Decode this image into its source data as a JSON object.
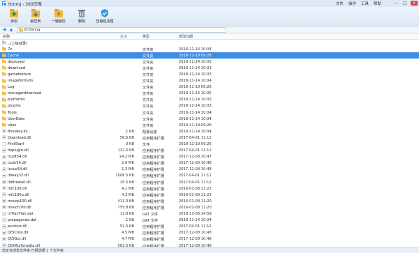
{
  "window": {
    "title": "ttmnq - 360压缩",
    "menu": [
      "文件",
      "操作",
      "工具",
      "帮助"
    ],
    "controls": [
      "−",
      "□",
      "×"
    ]
  },
  "toolbar": {
    "add_label": "添加",
    "extract_label": "解压到",
    "oneclick_label": "一键解压",
    "delete_label": "删除",
    "scan_label": "压缩包清理"
  },
  "address": {
    "path": "D:\\ttmnq"
  },
  "columns": {
    "name": "名称",
    "size": "大小",
    "type": "类型",
    "date": "修改日期"
  },
  "files": [
    {
      "name": "..(上级目录)",
      "size": "",
      "type": "",
      "date": "",
      "icon": "up-folder-icon"
    },
    {
      "name": "7z",
      "size": "",
      "type": "文件夹",
      "date": "2018-11-14 10:04",
      "icon": "folder-icon"
    },
    {
      "name": "Cache",
      "size": "",
      "type": "文件夹",
      "date": "2018-11-19 09:26",
      "icon": "folder-icon",
      "selected": true
    },
    {
      "name": "deployed",
      "size": "",
      "type": "文件夹",
      "date": "2018-11-14 10:05",
      "icon": "folder-icon"
    },
    {
      "name": "download",
      "size": "",
      "type": "文件夹",
      "date": "2018-11-14 10:03",
      "icon": "folder-icon"
    },
    {
      "name": "gametexture",
      "size": "",
      "type": "文件夹",
      "date": "2018-11-14 10:03",
      "icon": "folder-icon"
    },
    {
      "name": "imageformats",
      "size": "",
      "type": "文件夹",
      "date": "2018-11-14 10:04",
      "icon": "folder-icon"
    },
    {
      "name": "Log",
      "size": "",
      "type": "文件夹",
      "date": "2018-11-19 09:26",
      "icon": "folder-icon"
    },
    {
      "name": "managerdownload",
      "size": "",
      "type": "文件夹",
      "date": "2018-11-14 10:05",
      "icon": "folder-icon"
    },
    {
      "name": "platforms",
      "size": "",
      "type": "文件夹",
      "date": "2018-11-14 10:03",
      "icon": "folder-icon"
    },
    {
      "name": "plugins",
      "size": "",
      "type": "文件夹",
      "date": "2018-11-14 10:03",
      "icon": "folder-icon"
    },
    {
      "name": "Tools",
      "size": "",
      "type": "文件夹",
      "date": "2018-11-14 10:04",
      "icon": "folder-icon"
    },
    {
      "name": "UserData",
      "size": "",
      "type": "文件夹",
      "date": "2018-11-14 10:04",
      "icon": "folder-icon"
    },
    {
      "name": "vbox",
      "size": "",
      "type": "文件夹",
      "date": "2018-11-19 09:26",
      "icon": "folder-icon"
    },
    {
      "name": "BossKey.ini",
      "size": "1 KB",
      "type": "配置设置",
      "date": "2018-11-14 10:04",
      "icon": "settings-file-icon"
    },
    {
      "name": "Download.dll",
      "size": "56.5 KB",
      "type": "应用程序扩展",
      "date": "2017-04-01 11:12",
      "icon": "dll-file-icon"
    },
    {
      "name": "FirstStart",
      "size": "0 KB",
      "type": "文件",
      "date": "2018-11-19 09:26",
      "icon": "file-icon"
    },
    {
      "name": "fwplugin.dll",
      "size": "122.5 KB",
      "type": "应用程序扩展",
      "date": "2017-04-01 11:12",
      "icon": "dll-file-icon"
    },
    {
      "name": "icudt54.dll",
      "size": "24.2 MB",
      "type": "应用程序扩展",
      "date": "2017-12-08 10:47",
      "icon": "dll-file-icon"
    },
    {
      "name": "icuin54.dll",
      "size": "2.0 MB",
      "type": "应用程序扩展",
      "date": "2017-12-08 10:48",
      "icon": "dll-file-icon"
    },
    {
      "name": "icuuc54.dll",
      "size": "1.3 MB",
      "type": "应用程序扩展",
      "date": "2017-12-08 10:48",
      "icon": "dll-file-icon"
    },
    {
      "name": "libeay32.dll",
      "size": "1008.5 KB",
      "type": "应用程序扩展",
      "date": "2017-04-01 11:12",
      "icon": "dll-file-icon"
    },
    {
      "name": "libfirewall.dll",
      "size": "25.5 KB",
      "type": "应用程序扩展",
      "date": "2017-04-01 11:12",
      "icon": "dll-file-icon"
    },
    {
      "name": "mfc100.dll",
      "size": "4.1 MB",
      "type": "应用程序扩展",
      "date": "2016-01-08 11:22",
      "icon": "dll-file-icon"
    },
    {
      "name": "mfc100u.dll",
      "size": "4.2 MB",
      "type": "应用程序扩展",
      "date": "2016-01-08 11:22",
      "icon": "dll-file-icon"
    },
    {
      "name": "msvcp100.dll",
      "size": "411.3 KB",
      "type": "应用程序扩展",
      "date": "2016-01-08 11:20",
      "icon": "dll-file-icon"
    },
    {
      "name": "msvcr100.dll",
      "size": "755.8 KB",
      "type": "应用程序扩展",
      "date": "2016-01-08 11:20",
      "icon": "dll-file-icon"
    },
    {
      "name": "niTianTian.dat",
      "size": "11.8 KB",
      "type": "DAT 文件",
      "date": "2018-11-06 14:59",
      "icon": "dat-file-icon"
    },
    {
      "name": "propaganda.dat",
      "size": "1 KB",
      "type": "DAT 文件",
      "date": "2018-11-14 10:04",
      "icon": "dat-file-icon"
    },
    {
      "name": "psvince.dll",
      "size": "51.5 KB",
      "type": "应用程序扩展",
      "date": "2017-04-01 11:12",
      "icon": "dll-file-icon"
    },
    {
      "name": "Qt5Core.dll",
      "size": "4.5 MB",
      "type": "应用程序扩展",
      "date": "2017-12-08 10:48",
      "icon": "dll-file-icon"
    },
    {
      "name": "Qt5Gui.dll",
      "size": "4.7 MB",
      "type": "应用程序扩展",
      "date": "2017-12-08 10:48",
      "icon": "dll-file-icon"
    },
    {
      "name": "Qt5Multimedia.dll",
      "size": "562.5 KB",
      "type": "应用程序扩展",
      "date": "2017-12-08 10:48",
      "icon": "dll-file-icon"
    }
  ],
  "status": {
    "text": "您正在浏览文件夹 已经选择 1 个文件夹"
  },
  "colors": {
    "selection": "#3d8ee6",
    "folder": "#f2c24b",
    "toolbar_bg": "#dde8f5"
  }
}
